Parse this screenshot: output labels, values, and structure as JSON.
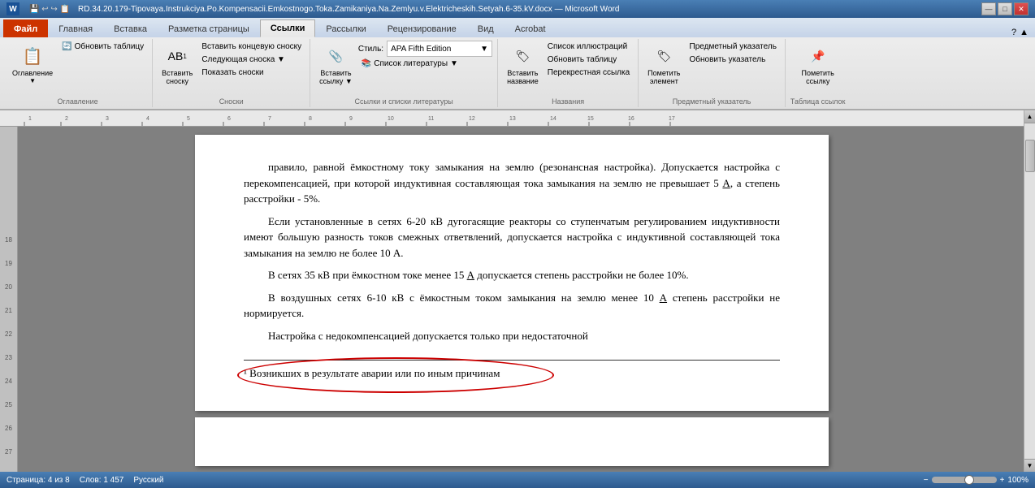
{
  "titleBar": {
    "title": "RD.34.20.179-Tipovaya.Instrukciya.Po.Kompensacii.Emkostnogo.Toka.Zamikaniya.Na.Zemlyu.v.Elektricheskih.Setyah.6-35.kV.docx — Microsoft Word",
    "controls": [
      "—",
      "□",
      "✕"
    ]
  },
  "ribbon": {
    "tabs": [
      "Файл",
      "Главная",
      "Вставка",
      "Разметка страницы",
      "Ссылки",
      "Рассылки",
      "Рецензирование",
      "Вид",
      "Acrobat"
    ],
    "activeTab": "Ссылки",
    "groups": [
      {
        "label": "Оглавление",
        "buttons": [
          "Оглавление",
          "Обновить таблицу"
        ]
      },
      {
        "label": "Сноски",
        "buttons": [
          "Вставить сноску",
          "Вставить концевую сноску",
          "Следующая сноска",
          "Показать сноски"
        ]
      },
      {
        "label": "Ссылки и списки литературы",
        "buttons": [
          "Вставить ссылку",
          "Стиль: APA Fifth Edition",
          "Список литературы"
        ]
      },
      {
        "label": "Названия",
        "buttons": [
          "Вставить название",
          "Список иллюстраций",
          "Обновить таблицу",
          "Перекрестная ссылка"
        ]
      },
      {
        "label": "Предметный указатель",
        "buttons": [
          "Пометить элемент",
          "Предметный указатель",
          "Обновить указатель"
        ]
      },
      {
        "label": "Таблица ссылок",
        "buttons": [
          "Пометить ссылку"
        ]
      }
    ],
    "styleValue": "APA Fifth Edition"
  },
  "document": {
    "page1": {
      "paragraphs": [
        "правило, равной ёмкостному току замыкания на землю (резонансная настройка). Допускается настройка с перекомпенсацией, при которой индуктивная составляющая тока замыкания на землю не превышает 5 А, а степень расстройки - 5%.",
        "Если установленные в сетях 6-20 кВ дугогасящие реакторы со ступенчатым регулированием индуктивности имеют большую разность токов смежных ответвлений, допускается настройка с индуктивной составляющей тока замыкания на землю не более 10 А.",
        "В сетях 35 кВ при ёмкостном токе менее 15 А допускается степень расстройки не более 10%.",
        "В воздушных сетях 6-10 кВ с ёмкостным током замыкания на землю менее 10 А степень расстройки не нормируется.",
        "Настройка с недокомпенсацией допускается только при недостаточной"
      ],
      "footnoteText": "¹ Возникших в результате аварии или по иным причинам"
    }
  },
  "statusBar": {
    "page": "Страница: 4 из 8",
    "words": "Слов: 1 457",
    "language": "Русский"
  },
  "icons": {
    "word": "W",
    "save": "💾",
    "undo": "↩",
    "redo": "↪",
    "print": "🖨",
    "scroll_up": "▲",
    "scroll_down": "▼"
  }
}
